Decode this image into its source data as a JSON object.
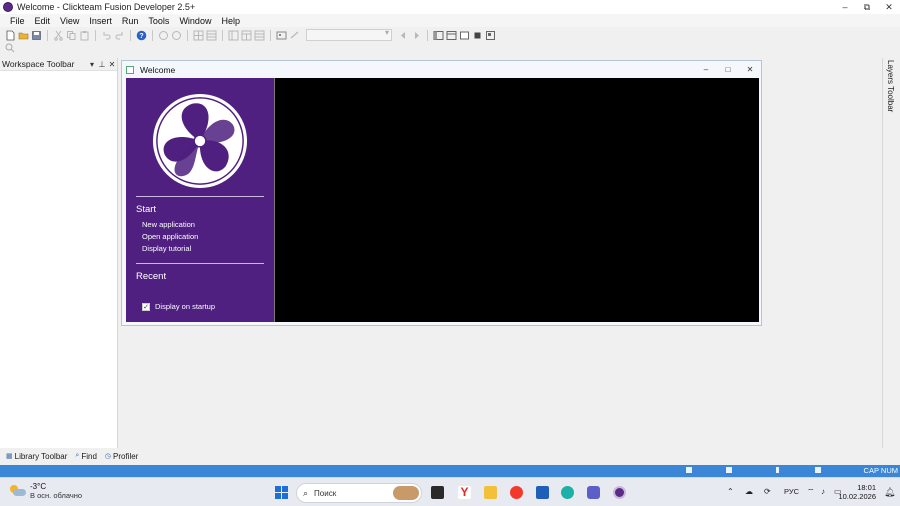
{
  "window": {
    "title": "Welcome - Clickteam Fusion Developer 2.5+",
    "minimize": "–",
    "maximize": "⧉",
    "close": "✕"
  },
  "menu": [
    "File",
    "Edit",
    "View",
    "Insert",
    "Run",
    "Tools",
    "Window",
    "Help"
  ],
  "workspace": {
    "title": "Workspace Toolbar",
    "dropdown": "▾",
    "pin": "⊥",
    "close": "✕"
  },
  "layers": {
    "title": "Layers Toolbar"
  },
  "welcome": {
    "title": "Welcome",
    "minimize": "–",
    "maximize": "□",
    "close": "✕",
    "start_heading": "Start",
    "links": [
      "New application",
      "Open application",
      "Display tutorial"
    ],
    "recent_heading": "Recent",
    "display_on_startup": "Display on startup",
    "display_on_startup_checked": true
  },
  "bottom_tabs": [
    "Library Toolbar",
    "Find",
    "Profiler"
  ],
  "statusbar": {
    "caps": "CAP NUM"
  },
  "taskbar": {
    "weather_temp": "-3°C",
    "weather_cond": "В осн. облачно",
    "search_placeholder": "Поиск",
    "language": "РУС",
    "time": "18:01",
    "date": "10.02.2026"
  },
  "colors": {
    "welcome_panel": "#4f2080",
    "statusbar": "#3b86d6",
    "preview": "#000000"
  }
}
